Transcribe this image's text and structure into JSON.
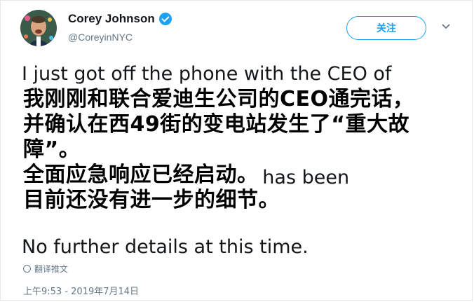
{
  "tweet": {
    "author": {
      "display_name": "Corey Johnson",
      "handle": "@CoreyinNYC",
      "verified_icon": "verified-badge-icon"
    },
    "follow_label": "关注",
    "text_lines": [
      "I just got off the phone with the CEO of",
      "",
      "",
      "",
      "                                        has been",
      "",
      "",
      "No further details at this time."
    ],
    "overlay_lines": [
      "我刚刚和联合爱迪生公司的CEO通完话，",
      "并确认在西49街的变电站发生了“重大故",
      "障”。",
      "全面应急响应已经启动。",
      "目前还没有进一步的细节。"
    ],
    "translate_label": "翻译推文",
    "timestamp": "上午9:53 - 2019年7月14日"
  },
  "colors": {
    "accent": "#1da1f2",
    "text": "#14171a",
    "secondary": "#657786"
  }
}
